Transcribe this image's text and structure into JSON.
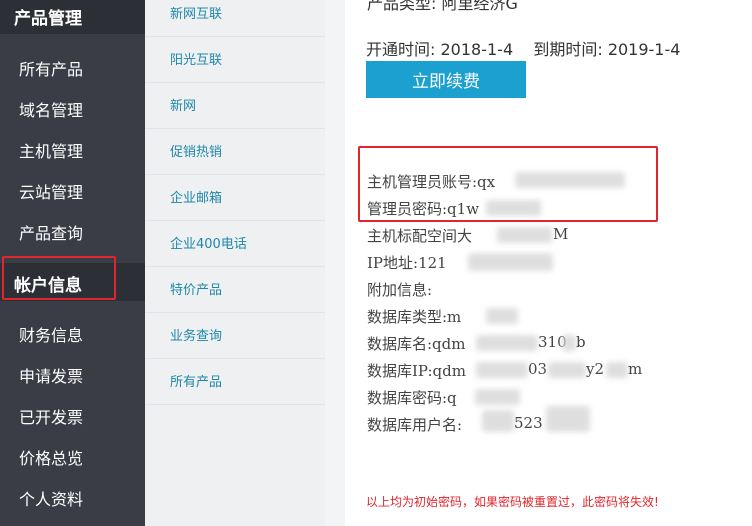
{
  "sidebar": {
    "product_section": "产品管理",
    "product_items": [
      "所有产品",
      "域名管理",
      "主机管理",
      "云站管理",
      "产品查询"
    ],
    "account_section": "帐户信息",
    "account_items": [
      "财务信息",
      "申请发票",
      "已开发票",
      "价格总览",
      "个人资料"
    ]
  },
  "midmenu": {
    "items": [
      "新网互联",
      "阳光互联",
      "新网",
      "促销热销",
      "企业邮箱",
      "企业400电话",
      "特价产品",
      "业务查询",
      "所有产品"
    ]
  },
  "content": {
    "product_type": "产品类型: 阿里经济G",
    "open_label": "开通时间:",
    "open_date": "2018-1-4",
    "expire_label": "到期时间:",
    "expire_date": "2019-1-4",
    "renew_button": "立即续费",
    "admin_account": "主机管理员账号:qx",
    "admin_password": "管理员密码:q1w",
    "space": "主机标配空间大",
    "space_unit": "M",
    "ip": "IP地址:121",
    "extra": "附加信息:",
    "db_type": "数据库类型:m",
    "db_name": "数据库名:qdm",
    "db_name_mid": "310",
    "db_name_end": "b",
    "db_ip": "数据库IP:qdm",
    "db_ip_mid": "03",
    "db_ip_mid2": "y2",
    "db_ip_end": "m",
    "db_password": "数据库密码:q",
    "db_user": "数据库用户名:",
    "db_user_mid": "523",
    "warning": "以上均为初始密码，如果密码被重置过，此密码将失效!"
  },
  "colors": {
    "sidebar_bg": "#3a3c46",
    "sidebar_section_bg": "#2d2f37",
    "midmenu_bg": "#eef0f2",
    "link_color": "#1f87a8",
    "button_bg": "#1ba0d0",
    "highlight_red": "#e0262c"
  }
}
